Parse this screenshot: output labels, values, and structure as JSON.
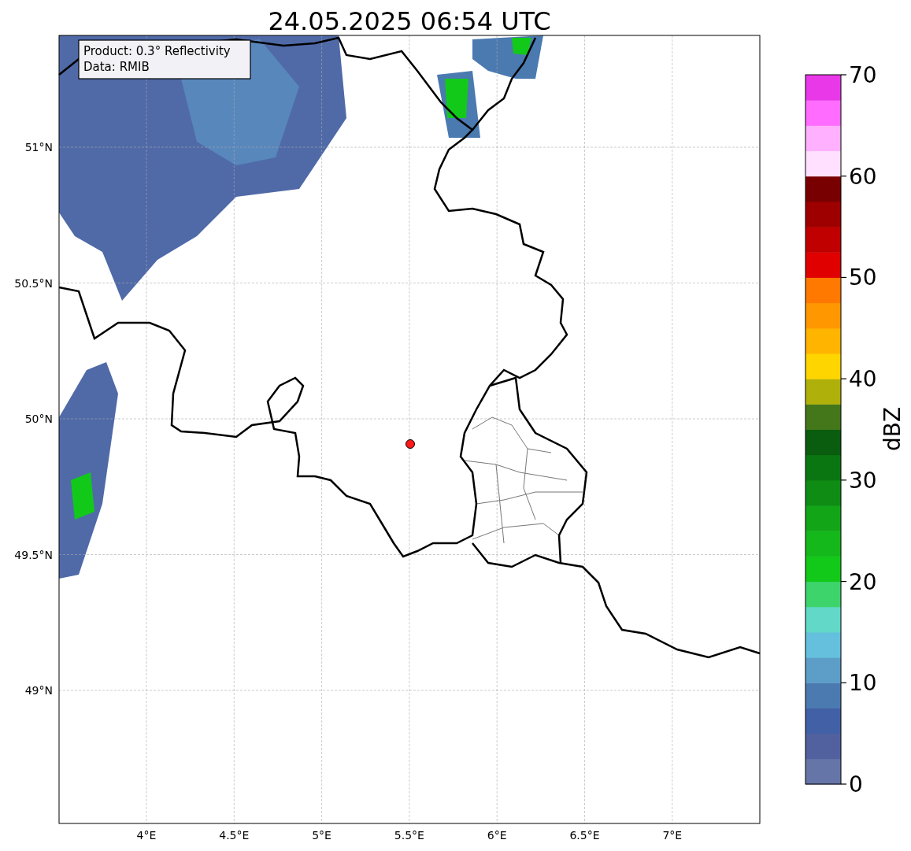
{
  "title": "24.05.2025 06:54 UTC",
  "annotation": {
    "lines": [
      "Product: 0.3° Reflectivity",
      "Data: RMIB"
    ]
  },
  "x_ticks": [
    "4°E",
    "4.5°E",
    "5°E",
    "5.5°E",
    "6°E",
    "6.5°E",
    "7°E"
  ],
  "y_ticks": [
    "51°N",
    "50.5°N",
    "50°N",
    "49.5°N",
    "49°N"
  ],
  "colorbar": {
    "label": "dBZ",
    "ticks": [
      "70",
      "60",
      "50",
      "40",
      "30",
      "20",
      "10",
      "0"
    ],
    "bins": [
      {
        "color": "#6675a8"
      },
      {
        "color": "#5161a0"
      },
      {
        "color": "#4260a5"
      },
      {
        "color": "#4a7ab0"
      },
      {
        "color": "#5c9ec8"
      },
      {
        "color": "#64c0dc"
      },
      {
        "color": "#62d8c8"
      },
      {
        "color": "#3ed46c"
      },
      {
        "color": "#12c91a"
      },
      {
        "color": "#14b81a"
      },
      {
        "color": "#12a518"
      },
      {
        "color": "#0e8c14"
      },
      {
        "color": "#0a7612"
      },
      {
        "color": "#0a5c0e"
      },
      {
        "color": "#44761a"
      },
      {
        "color": "#b0b00a"
      },
      {
        "color": "#ffd500"
      },
      {
        "color": "#ffb400"
      },
      {
        "color": "#ff9800"
      },
      {
        "color": "#ff7800"
      },
      {
        "color": "#e00000"
      },
      {
        "color": "#c00000"
      },
      {
        "color": "#9e0000"
      },
      {
        "color": "#780000"
      },
      {
        "color": "#ffe0ff"
      },
      {
        "color": "#ffb0ff"
      },
      {
        "color": "#ff6cff"
      },
      {
        "color": "#e838e8"
      }
    ]
  }
}
